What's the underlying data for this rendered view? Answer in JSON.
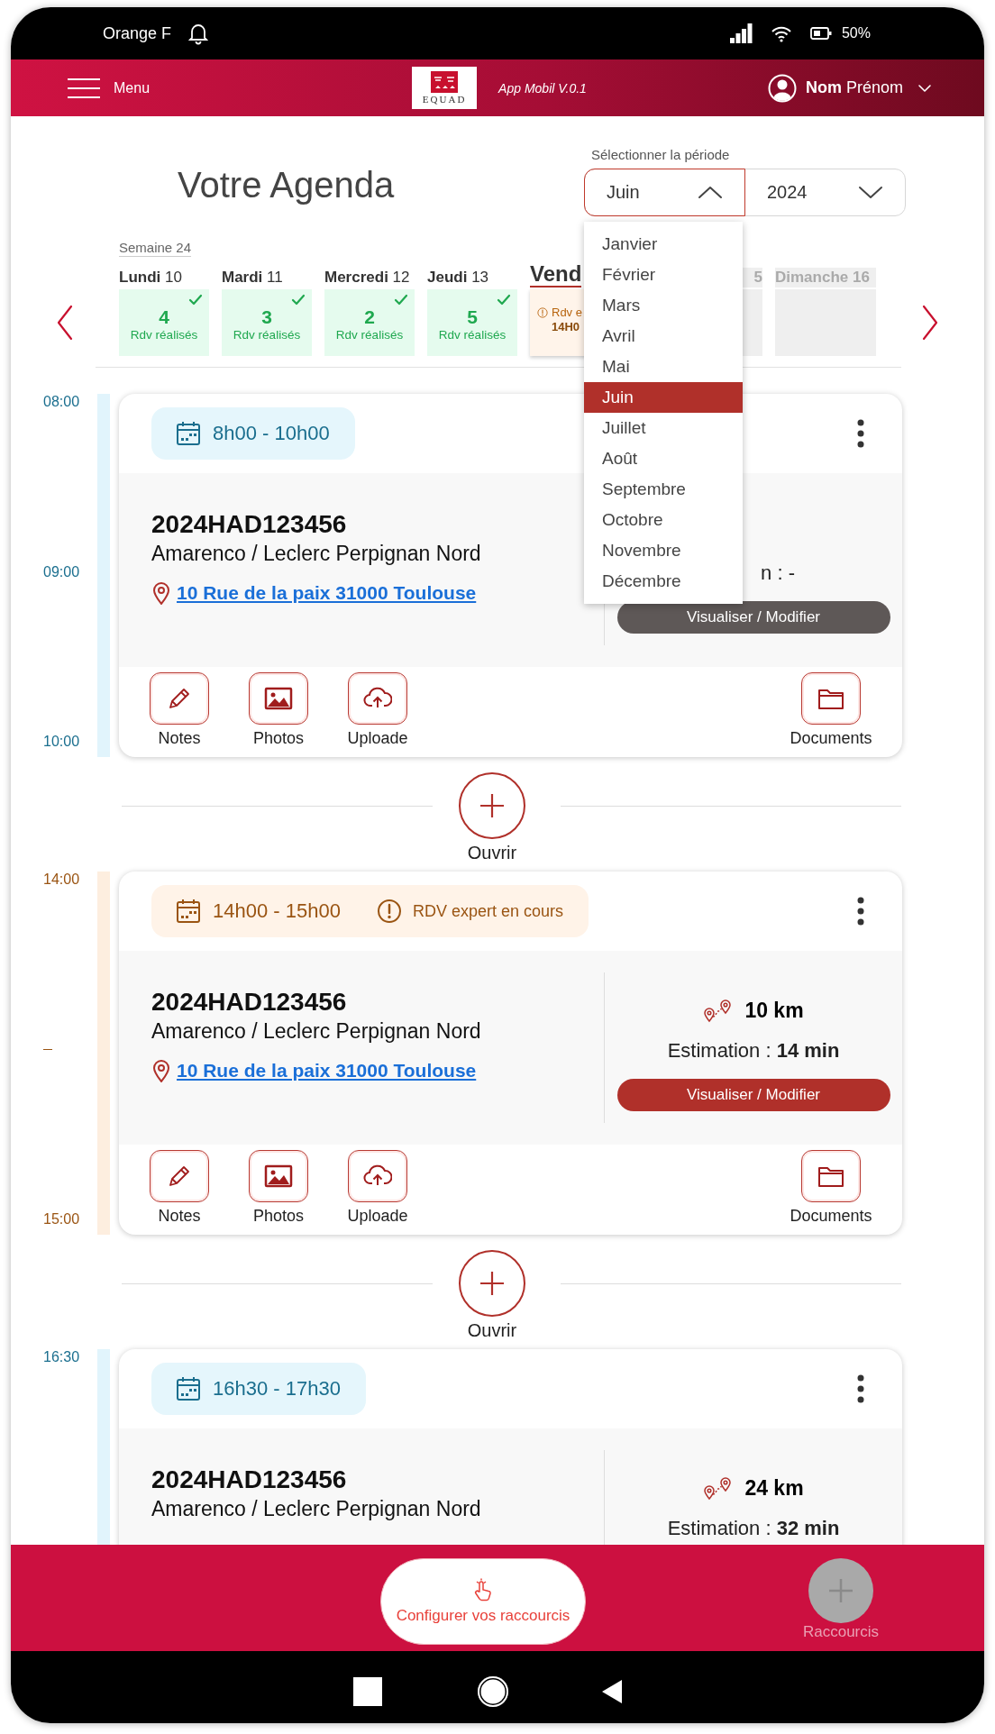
{
  "status_bar": {
    "carrier": "Orange F",
    "battery": "50%"
  },
  "header": {
    "menu_label": "Menu",
    "logo_text": "EQUAD",
    "app_version": "App Mobil V.0.1",
    "user_name": "**Nom** Prénom"
  },
  "agenda_title": "Votre Agenda",
  "period": {
    "label": "Sélectionner la période",
    "month": "Juin",
    "year": "2024",
    "open": true,
    "months": [
      {
        "label": "Janvier",
        "selected": false
      },
      {
        "label": "Février",
        "selected": false
      },
      {
        "label": "Mars",
        "selected": false
      },
      {
        "label": "Avril",
        "selected": false
      },
      {
        "label": "Mai",
        "selected": false
      },
      {
        "label": "Juin",
        "selected": true
      },
      {
        "label": "Juillet",
        "selected": false
      },
      {
        "label": "Août",
        "selected": false
      },
      {
        "label": "Septembre",
        "selected": false
      },
      {
        "label": "Octobre",
        "selected": false
      },
      {
        "label": "Novembre",
        "selected": false
      },
      {
        "label": "Décembre",
        "selected": false
      }
    ]
  },
  "week": {
    "label": "Semaine 24",
    "days": [
      {
        "label": "**Lundi** 10",
        "kind": "done",
        "count": "4",
        "caption": "Rdv réalisés",
        "selected": false
      },
      {
        "label": "**Mardi** 11",
        "kind": "done",
        "count": "3",
        "caption": "Rdv réalisés",
        "selected": false
      },
      {
        "label": "**Mercredi** 12",
        "kind": "done",
        "count": "2",
        "caption": "Rdv réalisés",
        "selected": false
      },
      {
        "label": "**Jeudi** 13",
        "kind": "done",
        "count": "5",
        "caption": "Rdv réalisés",
        "selected": false
      },
      {
        "label": "Vend",
        "kind": "in_progress",
        "caption": "Rdv e",
        "time": "14H0",
        "selected": true
      },
      {
        "label": "5",
        "kind": "empty",
        "selected": false
      },
      {
        "label": "Dimanche 16",
        "kind": "empty",
        "selected": false
      }
    ]
  },
  "agenda": [
    {
      "kind": "appointment",
      "in_progress": false,
      "times": [
        "08:00",
        "09:00",
        "10:00"
      ],
      "time_range": "8h00 - 10h00",
      "reference": "2024HAD123456",
      "client": "Amarenco / Leclerc Perpignan Nord",
      "address": "10 Rue de la paix 31000 Toulouse",
      "estimation": "n : -",
      "action": {
        "label": "Visualiser / Modifier",
        "disabled": true
      },
      "tools": [
        {
          "kind": "notes",
          "label": "Notes"
        },
        {
          "kind": "photos",
          "label": "Photos"
        },
        {
          "kind": "upload",
          "label": "Uploade"
        },
        {
          "kind": "documents",
          "label": "Documents"
        }
      ]
    },
    {
      "kind": "open_slot",
      "label": "Ouvrir"
    },
    {
      "kind": "appointment",
      "in_progress": true,
      "status_label": "RDV expert en cours",
      "times": [
        "14:00",
        "15:00"
      ],
      "time_range": "14h00 - 15h00",
      "reference": "2024HAD123456",
      "client": "Amarenco / Leclerc Perpignan Nord",
      "address": "10 Rue de la paix 31000 Toulouse",
      "distance": "10 km",
      "estimation": "Estimation : **14 min**",
      "action": {
        "label": "Visualiser / Modifier",
        "disabled": false
      },
      "tools": [
        {
          "kind": "notes",
          "label": "Notes"
        },
        {
          "kind": "photos",
          "label": "Photos"
        },
        {
          "kind": "upload",
          "label": "Uploade"
        },
        {
          "kind": "documents",
          "label": "Documents"
        }
      ]
    },
    {
      "kind": "open_slot",
      "label": "Ouvrir"
    },
    {
      "kind": "appointment",
      "in_progress": false,
      "times": [
        "16:30"
      ],
      "time_range": "16h30 - 17h30",
      "reference": "2024HAD123456",
      "client": "Amarenco / Leclerc Perpignan Nord",
      "distance": "24 km",
      "estimation": "Estimation : **32 min**"
    }
  ],
  "bottom_bar": {
    "configure_label": "Configurer vos raccourcis",
    "shortcuts_label": "Raccourcis"
  }
}
